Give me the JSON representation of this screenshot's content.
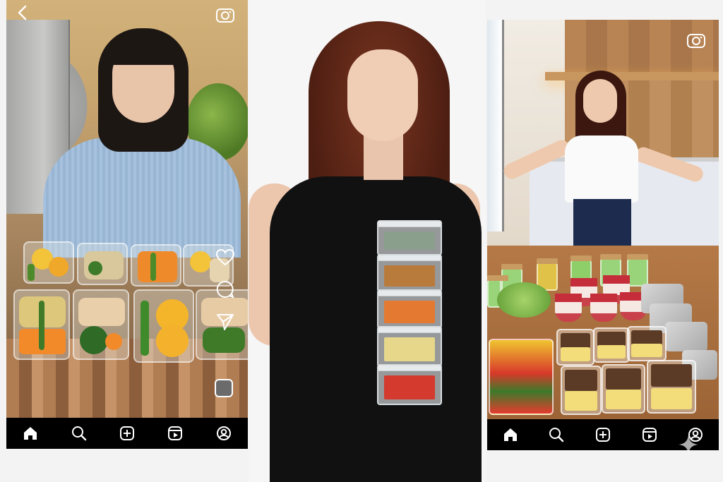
{
  "left_panel": {
    "icons": {
      "back": "chevron-left-icon",
      "camera": "camera-icon",
      "like": "heart-icon",
      "comment": "comment-icon",
      "share": "send-icon",
      "audio": "audio-thumbnail-icon"
    },
    "nav": [
      "home-icon",
      "search-icon",
      "create-icon",
      "reels-icon",
      "profile-icon"
    ]
  },
  "right_panel": {
    "icons": {
      "camera": "camera-icon"
    },
    "nav": [
      "home-icon",
      "search-icon",
      "create-icon",
      "reels-icon",
      "profile-icon"
    ]
  },
  "colors": {
    "nav_bg": "#000000",
    "icon": "#ffffff"
  }
}
